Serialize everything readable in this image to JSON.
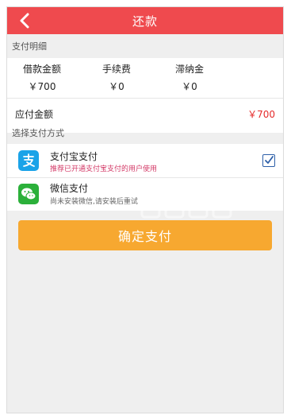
{
  "header": {
    "title": "还款"
  },
  "payment_details": {
    "section_label": "支付明细",
    "columns": [
      {
        "label": "借款金额",
        "value": "￥700"
      },
      {
        "label": "手续费",
        "value": "￥0"
      },
      {
        "label": "滞纳金",
        "value": "￥0"
      }
    ],
    "payable_label": "应付金额",
    "payable_value": "￥700"
  },
  "payment_methods": {
    "section_label": "选择支付方式",
    "items": [
      {
        "name": "支付宝支付",
        "description": "推荐已开通支付宝支付的用户使用",
        "icon": "alipay-icon",
        "selected": true
      },
      {
        "name": "微信支付",
        "description": "尚未安装微信,请安装后重试",
        "icon": "wechat-icon",
        "selected": false
      }
    ]
  },
  "confirm_button": {
    "label": "确定支付"
  },
  "colors": {
    "header": "#ef4a4e",
    "amount_red": "#e52b2b",
    "button": "#f7a830",
    "alipay": "#1aa3e8",
    "wechat": "#2bb03a",
    "recommend_text": "#d33a67"
  }
}
